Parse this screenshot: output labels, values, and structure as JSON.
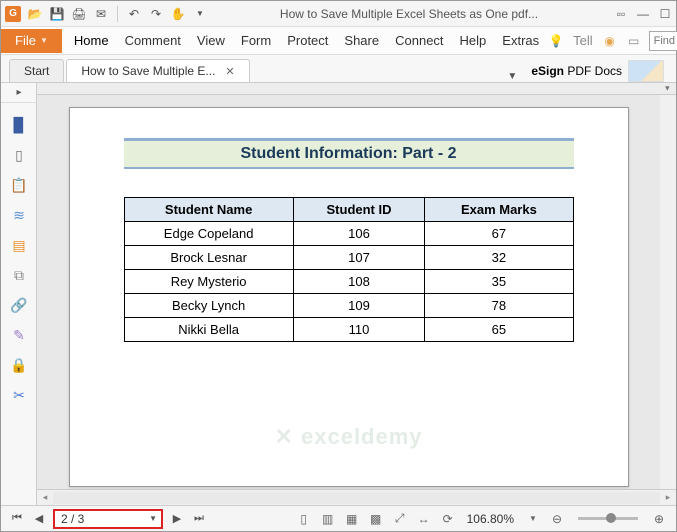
{
  "titlebar": {
    "app_glyph": "G",
    "title": "How to Save Multiple Excel Sheets as One pdf..."
  },
  "menubar": {
    "file": "File",
    "items": [
      "Home",
      "Comment",
      "View",
      "Form",
      "Protect",
      "Share",
      "Connect",
      "Help",
      "Extras"
    ],
    "tell": "Tell",
    "find_placeholder": "Find"
  },
  "tabs": {
    "tab1": "Start",
    "tab2": "How to Save Multiple E...",
    "esign_bold": "eSign",
    "esign_rest": " PDF Docs"
  },
  "sidenav": {
    "icons": [
      "bookmark-icon",
      "thumbnails-icon",
      "clipboard-icon",
      "layers-icon",
      "comments-icon",
      "attachments-icon",
      "links-icon",
      "signature-icon",
      "security-icon",
      "redact-icon"
    ],
    "glyphs": [
      "▉",
      "▯",
      "📋",
      "≋",
      "▤",
      "⧉",
      "🔗",
      "✎",
      "🔒",
      "✂"
    ]
  },
  "page": {
    "heading": "Student Information: Part - 2",
    "watermark": "✕ exceldemy"
  },
  "chart_data": {
    "type": "table",
    "columns": [
      "Student Name",
      "Student ID",
      "Exam Marks"
    ],
    "rows": [
      [
        "Edge Copeland",
        "106",
        "67"
      ],
      [
        "Brock Lesnar",
        "107",
        "32"
      ],
      [
        "Rey Mysterio",
        "108",
        "35"
      ],
      [
        "Becky Lynch",
        "109",
        "78"
      ],
      [
        "Nikki Bella",
        "110",
        "65"
      ]
    ]
  },
  "statusbar": {
    "page_field": "2 / 3",
    "zoom": "106.80%"
  }
}
